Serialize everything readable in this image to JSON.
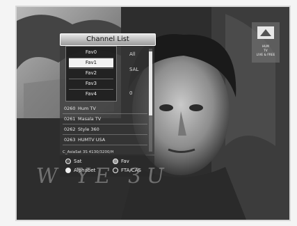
{
  "channel_list": {
    "title": "Channel List",
    "fav_dropdown": [
      "Fav0",
      "Fav1",
      "Fav2",
      "Fav3",
      "Fav4"
    ],
    "selected_fav": "Fav1",
    "hidden_column": [
      "All",
      "SAL",
      "0"
    ],
    "channels": [
      {
        "num": "0260",
        "name": "Hum TV"
      },
      {
        "num": "0261",
        "name": "Masala TV"
      },
      {
        "num": "0262",
        "name": "Style 360"
      },
      {
        "num": "0263",
        "name": "HUMTV USA"
      }
    ],
    "info_line": "C_AsiaSat 3S 4130/3200/H",
    "legend": [
      {
        "color": "red",
        "label": "Sat"
      },
      {
        "color": "green",
        "label": "Fav"
      },
      {
        "color": "yellow",
        "label": "Alphabet"
      },
      {
        "color": "blue",
        "label": "FTA/CAS"
      }
    ]
  },
  "logo": {
    "lines": [
      "HUM",
      "TV",
      "LIVE & FREE"
    ]
  },
  "watermark": "W  YE  3U"
}
